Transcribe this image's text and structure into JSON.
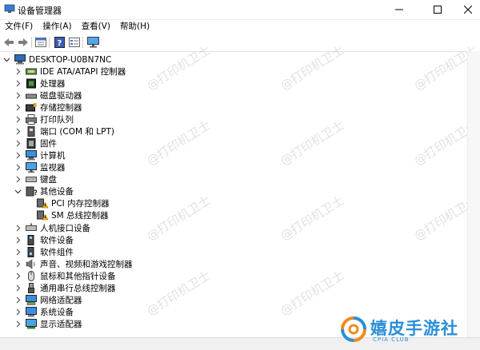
{
  "window": {
    "title": "设备管理器",
    "icon": "device-manager-icon",
    "controls": [
      "minimize-icon",
      "maximize-icon",
      "close-icon"
    ]
  },
  "menu": [
    "文件(F)",
    "操作(A)",
    "查看(V)",
    "帮助(H)"
  ],
  "toolbar": [
    "back-arrow-icon",
    "forward-arrow-icon",
    "properties-list-icon",
    "help-icon",
    "details-icon",
    "monitor-icon"
  ],
  "tree": {
    "root": "DESKTOP-U0BN7NC",
    "items": [
      {
        "label": "IDE ATA/ATAPI 控制器",
        "icon": "ide-controller-icon",
        "expanded": false
      },
      {
        "label": "处理器",
        "icon": "processor-icon",
        "expanded": false
      },
      {
        "label": "磁盘驱动器",
        "icon": "disk-drive-icon",
        "expanded": false
      },
      {
        "label": "存储控制器",
        "icon": "storage-controller-icon",
        "expanded": false
      },
      {
        "label": "打印队列",
        "icon": "printer-icon",
        "expanded": false
      },
      {
        "label": "端口 (COM 和 LPT)",
        "icon": "port-icon",
        "expanded": false
      },
      {
        "label": "固件",
        "icon": "firmware-icon",
        "expanded": false
      },
      {
        "label": "计算机",
        "icon": "computer-icon",
        "expanded": false
      },
      {
        "label": "监视器",
        "icon": "monitor-icon",
        "expanded": false
      },
      {
        "label": "键盘",
        "icon": "keyboard-icon",
        "expanded": false
      },
      {
        "label": "其他设备",
        "icon": "unknown-device-icon",
        "expanded": true,
        "children": [
          {
            "label": "PCI 内存控制器",
            "icon": "warning-device-icon"
          },
          {
            "label": "SM 总线控制器",
            "icon": "warning-device-icon"
          }
        ]
      },
      {
        "label": "人机接口设备",
        "icon": "hid-icon",
        "expanded": false
      },
      {
        "label": "软件设备",
        "icon": "software-device-icon",
        "expanded": false
      },
      {
        "label": "软件组件",
        "icon": "software-component-icon",
        "expanded": false
      },
      {
        "label": "声音、视频和游戏控制器",
        "icon": "audio-icon",
        "expanded": false
      },
      {
        "label": "鼠标和其他指针设备",
        "icon": "mouse-icon",
        "expanded": false
      },
      {
        "label": "通用串行总线控制器",
        "icon": "usb-icon",
        "expanded": false
      },
      {
        "label": "网络适配器",
        "icon": "network-adapter-icon",
        "expanded": false
      },
      {
        "label": "系统设备",
        "icon": "system-device-icon",
        "expanded": false
      },
      {
        "label": "显示适配器",
        "icon": "display-adapter-icon",
        "expanded": false
      }
    ]
  },
  "watermark": {
    "text": "@打印机卫士"
  },
  "brand": {
    "name": "嬉皮手游社",
    "subtitle": "CPIA CLUB",
    "color": "#2a8ed8"
  },
  "colors": {
    "accent": "#2a8ed8",
    "warning": "#f2b705"
  }
}
